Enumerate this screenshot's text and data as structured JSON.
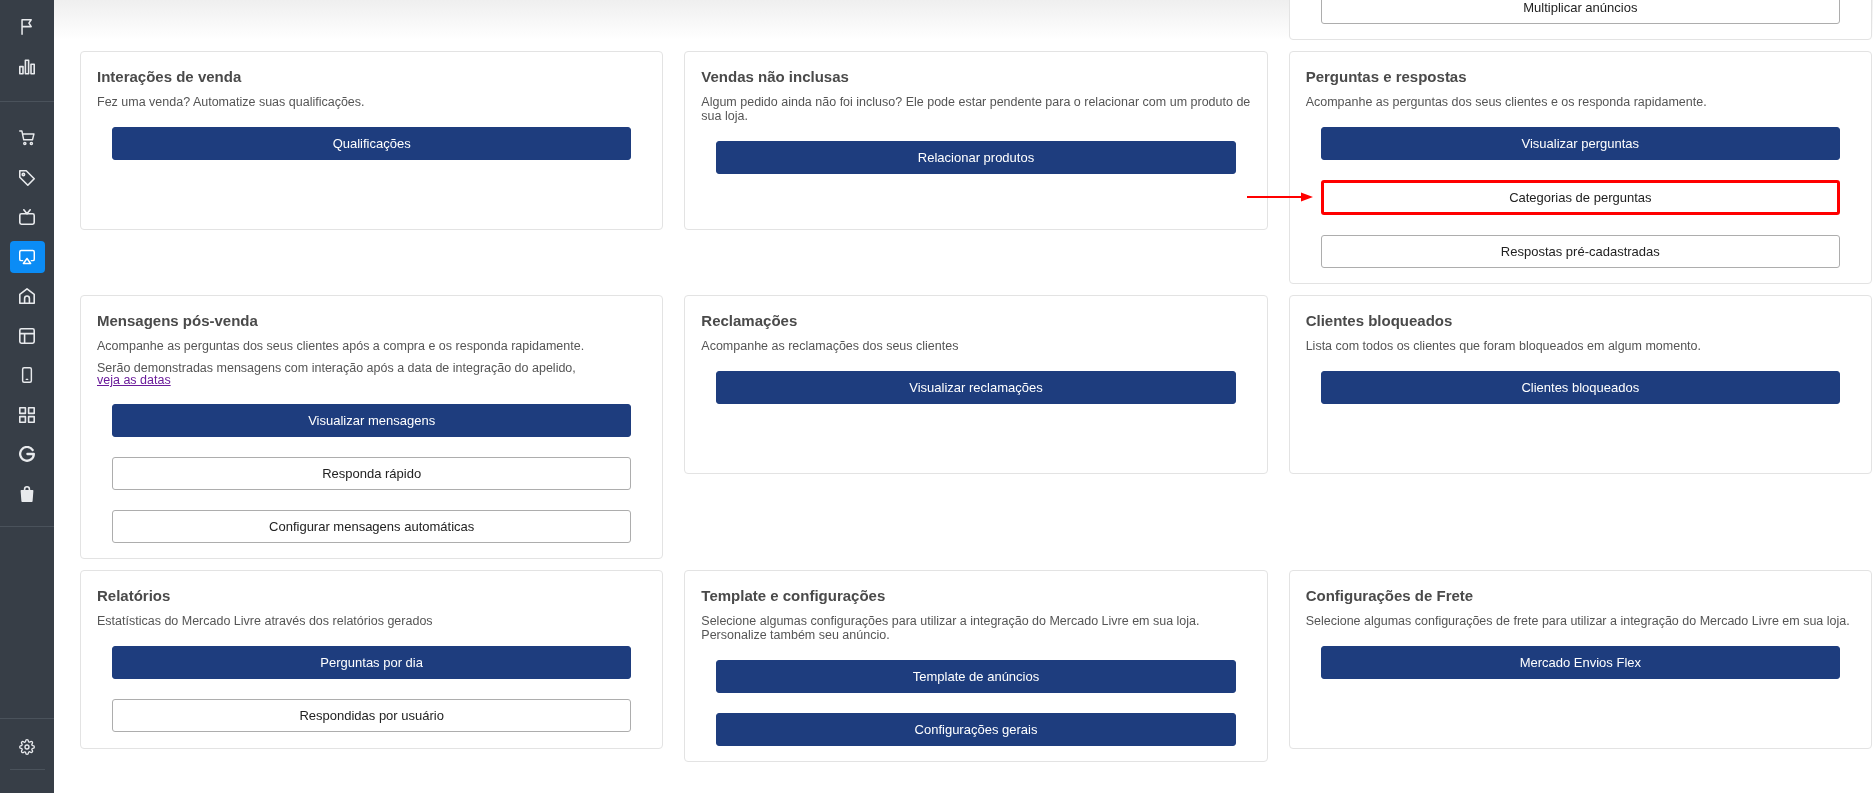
{
  "sidebar": {
    "groups": [
      {
        "items": [
          {
            "kind": "flag",
            "selected": false
          },
          {
            "kind": "chart",
            "selected": false
          }
        ]
      },
      {
        "items": [
          {
            "kind": "cart",
            "selected": false
          },
          {
            "kind": "tag",
            "selected": false
          },
          {
            "kind": "tv",
            "selected": false
          },
          {
            "kind": "cast",
            "selected": true
          },
          {
            "kind": "home",
            "selected": false
          },
          {
            "kind": "layout",
            "selected": false
          },
          {
            "kind": "phone",
            "selected": false
          },
          {
            "kind": "grid",
            "selected": false
          },
          {
            "kind": "letter_g",
            "selected": false
          },
          {
            "kind": "bag",
            "selected": false
          }
        ]
      }
    ],
    "footer": {
      "items": [
        {
          "kind": "gear",
          "selected": false
        }
      ]
    }
  },
  "partial_card": {
    "buttons": [
      {
        "label": "Multiplicar anúncios",
        "kind": "outline",
        "highlighted": false
      }
    ]
  },
  "cards": [
    {
      "title": "Interações de venda",
      "description": "Fez uma venda? Automatize suas qualificações.",
      "buttons": [
        {
          "label": "Qualificações",
          "kind": "primary",
          "highlighted": false
        }
      ]
    },
    {
      "title": "Vendas não inclusas",
      "description": "Algum pedido ainda não foi incluso? Ele pode estar pendente para o relacionar com um produto de sua loja.",
      "buttons": [
        {
          "label": "Relacionar produtos",
          "kind": "primary",
          "highlighted": false
        }
      ]
    },
    {
      "title": "Perguntas e respostas",
      "description": "Acompanhe as perguntas dos seus clientes e os responda rapidamente.",
      "buttons": [
        {
          "label": "Visualizar perguntas",
          "kind": "primary",
          "highlighted": false
        },
        {
          "label": "Categorias de perguntas",
          "kind": "outline",
          "highlighted": true
        },
        {
          "label": "Respostas pré-cadastradas",
          "kind": "outline",
          "highlighted": false
        }
      ]
    },
    {
      "title": "Mensagens pós-venda",
      "description": "Acompanhe as perguntas dos seus clientes após a compra e os responda rapidamente.",
      "note": {
        "text": "Serão demonstradas mensagens com interação após a data de integração do apelido,",
        "link": "veja as datas"
      },
      "buttons": [
        {
          "label": "Visualizar mensagens",
          "kind": "primary",
          "highlighted": false
        },
        {
          "label": "Responda rápido",
          "kind": "outline",
          "highlighted": false
        },
        {
          "label": "Configurar mensagens automáticas",
          "kind": "outline",
          "highlighted": false
        }
      ]
    },
    {
      "title": "Reclamações",
      "description": "Acompanhe as reclamações dos seus clientes",
      "buttons": [
        {
          "label": "Visualizar reclamações",
          "kind": "primary",
          "highlighted": false
        }
      ]
    },
    {
      "title": "Clientes bloqueados",
      "description": "Lista com todos os clientes que foram bloqueados em algum momento.",
      "buttons": [
        {
          "label": "Clientes bloqueados",
          "kind": "primary",
          "highlighted": false
        }
      ]
    },
    {
      "title": "Relatórios",
      "description": "Estatísticas do Mercado Livre através dos relatórios gerados",
      "buttons": [
        {
          "label": "Perguntas por dia",
          "kind": "primary",
          "highlighted": false
        },
        {
          "label": "Respondidas por usuário",
          "kind": "outline",
          "highlighted": false
        }
      ]
    },
    {
      "title": "Template e configurações",
      "description": "Selecione algumas configurações para utilizar a integração do Mercado Livre em sua loja. Personalize também seu anúncio.",
      "buttons": [
        {
          "label": "Template de anúncios",
          "kind": "primary",
          "highlighted": false
        },
        {
          "label": "Configurações gerais",
          "kind": "primary",
          "highlighted": false
        }
      ]
    },
    {
      "title": "Configurações de Frete",
      "description": "Selecione algumas configurações de frete para utilizar a integração do Mercado Livre em sua loja.",
      "buttons": [
        {
          "label": "Mercado Envios Flex",
          "kind": "primary",
          "highlighted": false
        }
      ]
    }
  ]
}
